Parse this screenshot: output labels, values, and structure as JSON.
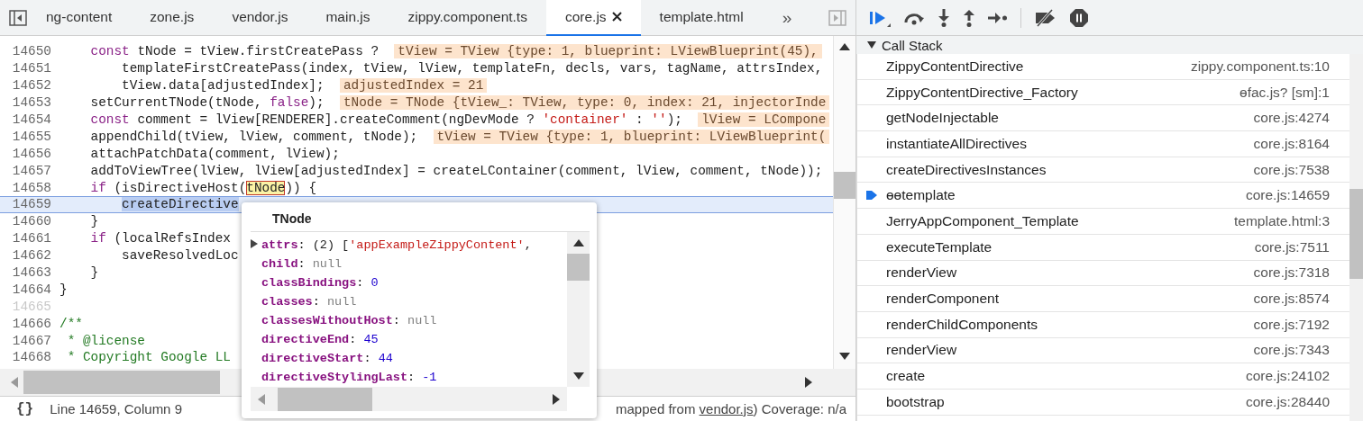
{
  "tabs": [
    {
      "label": "ng-content",
      "selected": false,
      "closable": false
    },
    {
      "label": "zone.js",
      "selected": false,
      "closable": false
    },
    {
      "label": "vendor.js",
      "selected": false,
      "closable": false
    },
    {
      "label": "main.js",
      "selected": false,
      "closable": false
    },
    {
      "label": "zippy.component.ts",
      "selected": false,
      "closable": false
    },
    {
      "label": "core.js",
      "selected": true,
      "closable": true
    },
    {
      "label": "template.html",
      "selected": false,
      "closable": false
    }
  ],
  "tabs_overflow": "»",
  "code_lines": [
    {
      "number": "14650",
      "current": false,
      "breakable": true,
      "segments": [
        {
          "text": "    const",
          "kind": "kw"
        },
        {
          "text": " tNode = tView.firstCreatePass ?  ",
          "kind": "plain"
        },
        {
          "text": "tView = TView {type: 1, blueprint: LViewBlueprint(45),",
          "kind": "value"
        }
      ]
    },
    {
      "number": "14651",
      "current": false,
      "breakable": true,
      "segments": [
        {
          "text": "        templateFirstCreatePass(index, tView, lView, templateFn, decls, vars, tagName, attrsIndex,",
          "kind": "plain"
        }
      ]
    },
    {
      "number": "14652",
      "current": false,
      "breakable": true,
      "segments": [
        {
          "text": "        tView.data[adjustedIndex];  ",
          "kind": "plain"
        },
        {
          "text": "adjustedIndex = 21",
          "kind": "value"
        }
      ]
    },
    {
      "number": "14653",
      "current": false,
      "breakable": true,
      "segments": [
        {
          "text": "    setCurrentTNode(tNode, ",
          "kind": "plain"
        },
        {
          "text": "false",
          "kind": "kw"
        },
        {
          "text": ");  ",
          "kind": "plain"
        },
        {
          "text": "tNode = TNode {tView_: TView, type: 0, index: 21, injectorInde",
          "kind": "value"
        }
      ]
    },
    {
      "number": "14654",
      "current": false,
      "breakable": true,
      "segments": [
        {
          "text": "    const",
          "kind": "kw"
        },
        {
          "text": " comment = lView[RENDERER].createComment(ngDevMode ? ",
          "kind": "plain"
        },
        {
          "text": "'container'",
          "kind": "str"
        },
        {
          "text": " : ",
          "kind": "plain"
        },
        {
          "text": "''",
          "kind": "str"
        },
        {
          "text": ");  ",
          "kind": "plain"
        },
        {
          "text": "lView = LCompone",
          "kind": "value"
        }
      ]
    },
    {
      "number": "14655",
      "current": false,
      "breakable": true,
      "segments": [
        {
          "text": "    appendChild(tView, lView, comment, tNode);  ",
          "kind": "plain"
        },
        {
          "text": "tView = TView {type: 1, blueprint: LViewBlueprint(",
          "kind": "value"
        }
      ]
    },
    {
      "number": "14656",
      "current": false,
      "breakable": true,
      "segments": [
        {
          "text": "    attachPatchData(comment, lView);",
          "kind": "plain"
        }
      ]
    },
    {
      "number": "14657",
      "current": false,
      "breakable": true,
      "segments": [
        {
          "text": "    addToViewTree(lView, lView[adjustedIndex] = createLContainer(comment, lView, comment, tNode));",
          "kind": "plain"
        }
      ]
    },
    {
      "number": "14658",
      "current": false,
      "breakable": true,
      "segments": [
        {
          "text": "    if",
          "kind": "kw"
        },
        {
          "text": " (isDirectiveHost(",
          "kind": "plain"
        },
        {
          "text": "tNode",
          "kind": "hover"
        },
        {
          "text": ")) {",
          "kind": "plain"
        }
      ]
    },
    {
      "number": "14659",
      "current": true,
      "breakable": true,
      "segments": [
        {
          "text": "        createDirective",
          "kind": "step"
        }
      ]
    },
    {
      "number": "14660",
      "current": false,
      "breakable": true,
      "segments": [
        {
          "text": "    }",
          "kind": "plain"
        }
      ]
    },
    {
      "number": "14661",
      "current": false,
      "breakable": true,
      "segments": [
        {
          "text": "    if",
          "kind": "kw"
        },
        {
          "text": " (localRefsIndex",
          "kind": "plain"
        }
      ]
    },
    {
      "number": "14662",
      "current": false,
      "breakable": true,
      "segments": [
        {
          "text": "        saveResolvedLoc",
          "kind": "plain"
        }
      ]
    },
    {
      "number": "14663",
      "current": false,
      "breakable": true,
      "segments": [
        {
          "text": "    }",
          "kind": "plain"
        }
      ]
    },
    {
      "number": "14664",
      "current": false,
      "breakable": true,
      "segments": [
        {
          "text": "}",
          "kind": "plain"
        }
      ]
    },
    {
      "number": "14665",
      "current": false,
      "breakable": false
    },
    {
      "number": "14666",
      "current": false,
      "breakable": true,
      "segments": [
        {
          "text": "/**",
          "kind": "comment"
        }
      ]
    },
    {
      "number": "14667",
      "current": false,
      "breakable": true,
      "segments": [
        {
          "text": " * @license",
          "kind": "comment"
        }
      ]
    },
    {
      "number": "14668",
      "current": false,
      "breakable": true,
      "segments": [
        {
          "text": " * Copyright Google LL",
          "kind": "comment"
        }
      ]
    }
  ],
  "popover": {
    "title": "TNode",
    "properties": [
      {
        "name": "attrs",
        "expandable": true,
        "value": [
          {
            "text": ": (2) [",
            "kind": "plain"
          },
          {
            "text": "'appExampleZippyContent'",
            "kind": "str"
          },
          {
            "text": ",",
            "kind": "plain"
          }
        ]
      },
      {
        "name": "child",
        "expandable": false,
        "value": [
          {
            "text": ":",
            "kind": "plain"
          },
          {
            "text": " null",
            "kind": "null"
          }
        ]
      },
      {
        "name": "classBindings",
        "expandable": false,
        "value": [
          {
            "text": ":",
            "kind": "plain"
          },
          {
            "text": " 0",
            "kind": "num"
          }
        ]
      },
      {
        "name": "classes",
        "expandable": false,
        "value": [
          {
            "text": ":",
            "kind": "plain"
          },
          {
            "text": " null",
            "kind": "null"
          }
        ]
      },
      {
        "name": "classesWithoutHost",
        "expandable": false,
        "value": [
          {
            "text": ":",
            "kind": "plain"
          },
          {
            "text": " null",
            "kind": "null"
          }
        ]
      },
      {
        "name": "directiveEnd",
        "expandable": false,
        "value": [
          {
            "text": ":",
            "kind": "plain"
          },
          {
            "text": " 45",
            "kind": "num"
          }
        ]
      },
      {
        "name": "directiveStart",
        "expandable": false,
        "value": [
          {
            "text": ":",
            "kind": "plain"
          },
          {
            "text": " 44",
            "kind": "num"
          }
        ]
      },
      {
        "name": "directiveStylingLast",
        "expandable": false,
        "value": [
          {
            "text": ":",
            "kind": "plain"
          },
          {
            "text": " -1",
            "kind": "num"
          }
        ]
      }
    ]
  },
  "status_bar": {
    "format_button": "{}",
    "position": "Line 14659, Column 9",
    "source_before": "mapped from ",
    "source_link": "vendor.js",
    "source_after": ")  Coverage: n/a"
  },
  "call_stack": {
    "title": "Call Stack",
    "expanded": true,
    "frames": [
      {
        "name": "ZippyContentDirective",
        "location": "zippy.component.ts:10",
        "selected": false
      },
      {
        "name": "ZippyContentDirective_Factory",
        "location": "ɵfac.js? [sm]:1",
        "selected": false
      },
      {
        "name": "getNodeInjectable",
        "location": "core.js:4274",
        "selected": false
      },
      {
        "name": "instantiateAllDirectives",
        "location": "core.js:8164",
        "selected": false
      },
      {
        "name": "createDirectivesInstances",
        "location": "core.js:7538",
        "selected": false
      },
      {
        "name": "ɵɵtemplate",
        "location": "core.js:14659",
        "selected": true
      },
      {
        "name": "JerryAppComponent_Template",
        "location": "template.html:3",
        "selected": false
      },
      {
        "name": "executeTemplate",
        "location": "core.js:7511",
        "selected": false
      },
      {
        "name": "renderView",
        "location": "core.js:7318",
        "selected": false
      },
      {
        "name": "renderComponent",
        "location": "core.js:8574",
        "selected": false
      },
      {
        "name": "renderChildComponents",
        "location": "core.js:7192",
        "selected": false
      },
      {
        "name": "renderView",
        "location": "core.js:7343",
        "selected": false
      },
      {
        "name": "create",
        "location": "core.js:24102",
        "selected": false
      },
      {
        "name": "bootstrap",
        "location": "core.js:28440",
        "selected": false
      }
    ]
  }
}
